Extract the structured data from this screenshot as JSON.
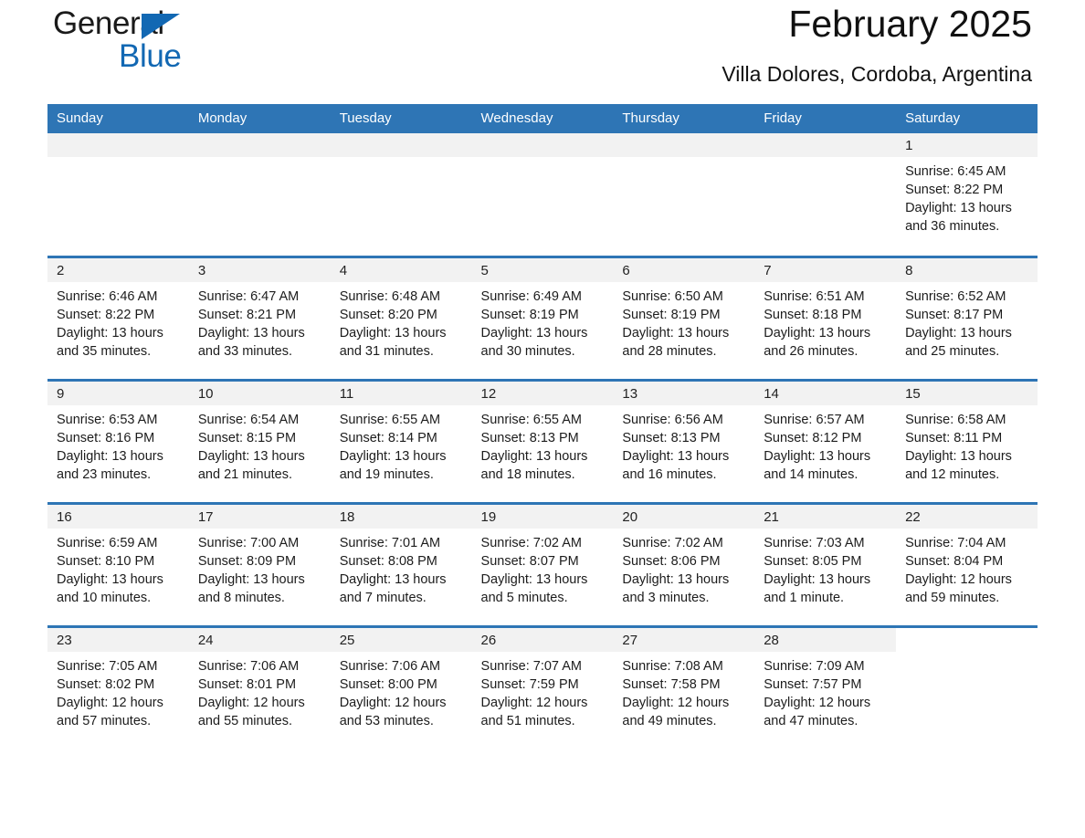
{
  "brand": {
    "name_part1": "General",
    "name_part2": "Blue",
    "triangle_icon": "brand-triangle-icon",
    "accent_color": "#1268b3"
  },
  "header": {
    "title": "February 2025",
    "subtitle": "Villa Dolores, Cordoba, Argentina"
  },
  "colors": {
    "header_blue": "#2e75b5",
    "row_divider_blue": "#2e75b5",
    "daynum_band": "#f2f2f2",
    "text": "#111111"
  },
  "weekday_headers": [
    "Sunday",
    "Monday",
    "Tuesday",
    "Wednesday",
    "Thursday",
    "Friday",
    "Saturday"
  ],
  "labels": {
    "sunrise_prefix": "Sunrise:",
    "sunset_prefix": "Sunset:",
    "daylight_prefix": "Daylight:"
  },
  "weeks": [
    [
      {
        "day": "",
        "sunrise": "",
        "sunset": "",
        "daylight_line1": "",
        "daylight_line2": "",
        "empty": true
      },
      {
        "day": "",
        "sunrise": "",
        "sunset": "",
        "daylight_line1": "",
        "daylight_line2": "",
        "empty": true
      },
      {
        "day": "",
        "sunrise": "",
        "sunset": "",
        "daylight_line1": "",
        "daylight_line2": "",
        "empty": true
      },
      {
        "day": "",
        "sunrise": "",
        "sunset": "",
        "daylight_line1": "",
        "daylight_line2": "",
        "empty": true
      },
      {
        "day": "",
        "sunrise": "",
        "sunset": "",
        "daylight_line1": "",
        "daylight_line2": "",
        "empty": true
      },
      {
        "day": "",
        "sunrise": "",
        "sunset": "",
        "daylight_line1": "",
        "daylight_line2": "",
        "empty": true
      },
      {
        "day": "1",
        "sunrise": "Sunrise: 6:45 AM",
        "sunset": "Sunset: 8:22 PM",
        "daylight_line1": "Daylight: 13 hours",
        "daylight_line2": "and 36 minutes."
      }
    ],
    [
      {
        "day": "2",
        "sunrise": "Sunrise: 6:46 AM",
        "sunset": "Sunset: 8:22 PM",
        "daylight_line1": "Daylight: 13 hours",
        "daylight_line2": "and 35 minutes."
      },
      {
        "day": "3",
        "sunrise": "Sunrise: 6:47 AM",
        "sunset": "Sunset: 8:21 PM",
        "daylight_line1": "Daylight: 13 hours",
        "daylight_line2": "and 33 minutes."
      },
      {
        "day": "4",
        "sunrise": "Sunrise: 6:48 AM",
        "sunset": "Sunset: 8:20 PM",
        "daylight_line1": "Daylight: 13 hours",
        "daylight_line2": "and 31 minutes."
      },
      {
        "day": "5",
        "sunrise": "Sunrise: 6:49 AM",
        "sunset": "Sunset: 8:19 PM",
        "daylight_line1": "Daylight: 13 hours",
        "daylight_line2": "and 30 minutes."
      },
      {
        "day": "6",
        "sunrise": "Sunrise: 6:50 AM",
        "sunset": "Sunset: 8:19 PM",
        "daylight_line1": "Daylight: 13 hours",
        "daylight_line2": "and 28 minutes."
      },
      {
        "day": "7",
        "sunrise": "Sunrise: 6:51 AM",
        "sunset": "Sunset: 8:18 PM",
        "daylight_line1": "Daylight: 13 hours",
        "daylight_line2": "and 26 minutes."
      },
      {
        "day": "8",
        "sunrise": "Sunrise: 6:52 AM",
        "sunset": "Sunset: 8:17 PM",
        "daylight_line1": "Daylight: 13 hours",
        "daylight_line2": "and 25 minutes."
      }
    ],
    [
      {
        "day": "9",
        "sunrise": "Sunrise: 6:53 AM",
        "sunset": "Sunset: 8:16 PM",
        "daylight_line1": "Daylight: 13 hours",
        "daylight_line2": "and 23 minutes."
      },
      {
        "day": "10",
        "sunrise": "Sunrise: 6:54 AM",
        "sunset": "Sunset: 8:15 PM",
        "daylight_line1": "Daylight: 13 hours",
        "daylight_line2": "and 21 minutes."
      },
      {
        "day": "11",
        "sunrise": "Sunrise: 6:55 AM",
        "sunset": "Sunset: 8:14 PM",
        "daylight_line1": "Daylight: 13 hours",
        "daylight_line2": "and 19 minutes."
      },
      {
        "day": "12",
        "sunrise": "Sunrise: 6:55 AM",
        "sunset": "Sunset: 8:13 PM",
        "daylight_line1": "Daylight: 13 hours",
        "daylight_line2": "and 18 minutes."
      },
      {
        "day": "13",
        "sunrise": "Sunrise: 6:56 AM",
        "sunset": "Sunset: 8:13 PM",
        "daylight_line1": "Daylight: 13 hours",
        "daylight_line2": "and 16 minutes."
      },
      {
        "day": "14",
        "sunrise": "Sunrise: 6:57 AM",
        "sunset": "Sunset: 8:12 PM",
        "daylight_line1": "Daylight: 13 hours",
        "daylight_line2": "and 14 minutes."
      },
      {
        "day": "15",
        "sunrise": "Sunrise: 6:58 AM",
        "sunset": "Sunset: 8:11 PM",
        "daylight_line1": "Daylight: 13 hours",
        "daylight_line2": "and 12 minutes."
      }
    ],
    [
      {
        "day": "16",
        "sunrise": "Sunrise: 6:59 AM",
        "sunset": "Sunset: 8:10 PM",
        "daylight_line1": "Daylight: 13 hours",
        "daylight_line2": "and 10 minutes."
      },
      {
        "day": "17",
        "sunrise": "Sunrise: 7:00 AM",
        "sunset": "Sunset: 8:09 PM",
        "daylight_line1": "Daylight: 13 hours",
        "daylight_line2": "and 8 minutes."
      },
      {
        "day": "18",
        "sunrise": "Sunrise: 7:01 AM",
        "sunset": "Sunset: 8:08 PM",
        "daylight_line1": "Daylight: 13 hours",
        "daylight_line2": "and 7 minutes."
      },
      {
        "day": "19",
        "sunrise": "Sunrise: 7:02 AM",
        "sunset": "Sunset: 8:07 PM",
        "daylight_line1": "Daylight: 13 hours",
        "daylight_line2": "and 5 minutes."
      },
      {
        "day": "20",
        "sunrise": "Sunrise: 7:02 AM",
        "sunset": "Sunset: 8:06 PM",
        "daylight_line1": "Daylight: 13 hours",
        "daylight_line2": "and 3 minutes."
      },
      {
        "day": "21",
        "sunrise": "Sunrise: 7:03 AM",
        "sunset": "Sunset: 8:05 PM",
        "daylight_line1": "Daylight: 13 hours",
        "daylight_line2": "and 1 minute."
      },
      {
        "day": "22",
        "sunrise": "Sunrise: 7:04 AM",
        "sunset": "Sunset: 8:04 PM",
        "daylight_line1": "Daylight: 12 hours",
        "daylight_line2": "and 59 minutes."
      }
    ],
    [
      {
        "day": "23",
        "sunrise": "Sunrise: 7:05 AM",
        "sunset": "Sunset: 8:02 PM",
        "daylight_line1": "Daylight: 12 hours",
        "daylight_line2": "and 57 minutes."
      },
      {
        "day": "24",
        "sunrise": "Sunrise: 7:06 AM",
        "sunset": "Sunset: 8:01 PM",
        "daylight_line1": "Daylight: 12 hours",
        "daylight_line2": "and 55 minutes."
      },
      {
        "day": "25",
        "sunrise": "Sunrise: 7:06 AM",
        "sunset": "Sunset: 8:00 PM",
        "daylight_line1": "Daylight: 12 hours",
        "daylight_line2": "and 53 minutes."
      },
      {
        "day": "26",
        "sunrise": "Sunrise: 7:07 AM",
        "sunset": "Sunset: 7:59 PM",
        "daylight_line1": "Daylight: 12 hours",
        "daylight_line2": "and 51 minutes."
      },
      {
        "day": "27",
        "sunrise": "Sunrise: 7:08 AM",
        "sunset": "Sunset: 7:58 PM",
        "daylight_line1": "Daylight: 12 hours",
        "daylight_line2": "and 49 minutes."
      },
      {
        "day": "28",
        "sunrise": "Sunrise: 7:09 AM",
        "sunset": "Sunset: 7:57 PM",
        "daylight_line1": "Daylight: 12 hours",
        "daylight_line2": "and 47 minutes."
      },
      {
        "day": "",
        "sunrise": "",
        "sunset": "",
        "daylight_line1": "",
        "daylight_line2": "",
        "blank": true
      }
    ]
  ]
}
